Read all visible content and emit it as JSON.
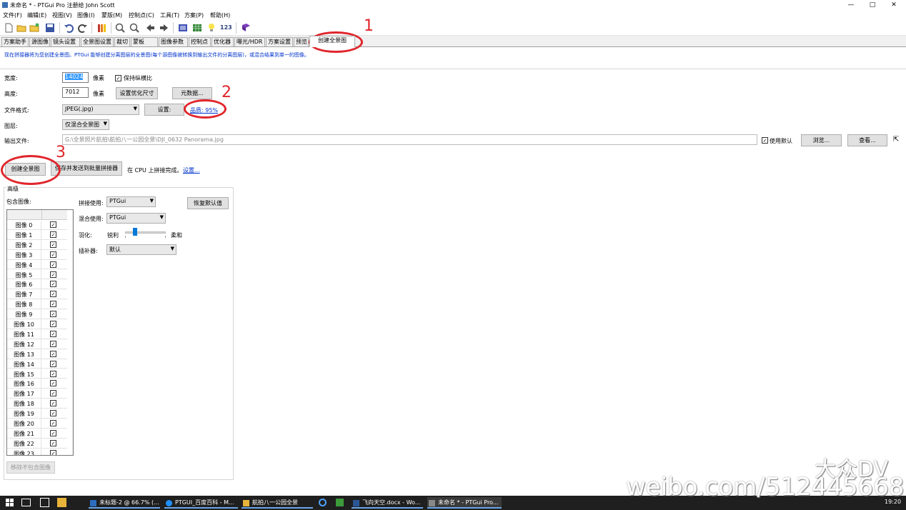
{
  "window": {
    "title": "未命名 * - PTGui Pro 注册给 John Scott",
    "controls": [
      "—",
      "□",
      "✕"
    ]
  },
  "menu": [
    "文件(F)",
    "编辑(E)",
    "视图(V)",
    "图像(I)",
    "蒙版(M)",
    "控制点(C)",
    "工具(T)",
    "方案(P)",
    "帮助(H)"
  ],
  "toolbar": {
    "icons": [
      "new-icon",
      "open-icon",
      "open-recent-icon",
      "save-icon",
      "undo-icon",
      "redo-icon",
      "tools-icon",
      "zoom-in-icon",
      "zoom-out-icon",
      "arrow-left-icon",
      "arrow-right-icon",
      "panorama-editor-icon",
      "table-icon",
      "lightbulb-icon",
      "numbers-icon",
      "book-icon"
    ],
    "numbers_label": "123"
  },
  "tabs": [
    "方案助手",
    "源图像",
    "镜头设置",
    "全景图设置",
    "裁切",
    "蒙板",
    "图像参数",
    "控制点",
    "优化器",
    "曝光/HDR",
    "方案设置",
    "预览",
    "创建全景图"
  ],
  "active_tab": "创建全景图",
  "intro": "现在拼接器将为您创建全景图。PTGui 能够创建分离图层的全景图(每个源图像被转换到输出文件的分离图层)，或混合结果到单一的图像。",
  "form": {
    "width_label": "宽度:",
    "width_value": "14024",
    "width_unit": "像素",
    "keep_ratio_label": "保持纵横比",
    "height_label": "高度:",
    "height_value": "7012",
    "height_unit": "像素",
    "set_optimal_button": "设置优化尺寸",
    "metadata_button": "元数据...",
    "format_label": "文件格式:",
    "format_value": "JPEG(.jpg)",
    "settings_button": "设置:",
    "quality_link": "品质: 95%",
    "layers_label": "图层:",
    "layers_value": "仅混合全景图",
    "output_label": "输出文件:",
    "output_value": "G:\\全景照片航拍\\航拍八一公园全景\\DJI_0632 Panorama.jpg",
    "use_default_label": "使用默认",
    "browse_button": "浏览...",
    "view_button": "查看..."
  },
  "actions": {
    "create_button": "创建全景图",
    "save_batch_button": "保存并发送到批量拼接器",
    "cpu_status": "在 CPU 上拼接完成。",
    "settings_link": "设置..."
  },
  "advanced": {
    "title": "高级",
    "include_label": "包含图像:",
    "images": [
      "图像 0",
      "图像 1",
      "图像 2",
      "图像 3",
      "图像 4",
      "图像 5",
      "图像 6",
      "图像 7",
      "图像 8",
      "图像 9",
      "图像 10",
      "图像 11",
      "图像 12",
      "图像 13",
      "图像 14",
      "图像 15",
      "图像 16",
      "图像 17",
      "图像 18",
      "图像 19",
      "图像 20",
      "图像 21",
      "图像 22",
      "图像 23"
    ],
    "stitch_label": "拼接使用:",
    "stitch_value": "PTGui",
    "blend_label": "混合使用:",
    "blend_value": "PTGui",
    "feather_label": "羽化:",
    "sharp_label": "锐利",
    "soft_label": "柔和",
    "feather_level": 0.22,
    "interp_label": "插补器:",
    "interp_value": "默认",
    "restore_button": "恢复默认值",
    "remove_button": "移除不包含图像"
  },
  "annotations": [
    "1",
    "2",
    "3"
  ],
  "taskbar": {
    "tasks": [
      "未标题-2 @ 66.7% (...",
      "PTGUI_百度百科 - M...",
      "航拍八一公园全景",
      "飞向天空.docx - Wo...",
      "未命名 * - PTGui Pro..."
    ],
    "clock": "19:20"
  },
  "watermark": {
    "brand": "大众DV",
    "url": "weibo.com/512445668"
  },
  "colors": {
    "annotation": "#e0262c",
    "link": "#0033cc",
    "selection": "#3399ff"
  }
}
